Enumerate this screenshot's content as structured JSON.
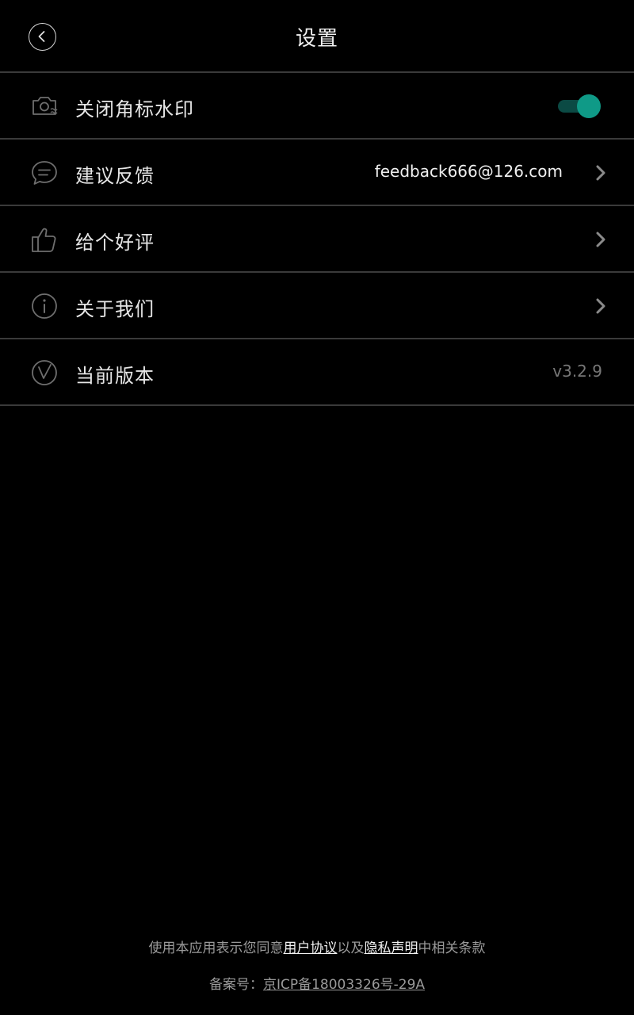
{
  "header": {
    "title": "设置",
    "back_icon": "chevron-left-icon"
  },
  "settings": [
    {
      "label": "关闭角标水印",
      "icon": "camera-watermark-icon",
      "control": "toggle",
      "toggle_on": true
    },
    {
      "label": "建议反馈",
      "icon": "message-icon",
      "value": "feedback666@126.com",
      "control": "chevron"
    },
    {
      "label": "给个好评",
      "icon": "thumbs-up-icon",
      "control": "chevron"
    },
    {
      "label": "关于我们",
      "icon": "info-icon",
      "control": "chevron"
    },
    {
      "label": "当前版本",
      "icon": "version-v-icon",
      "value": "v3.2.9",
      "control": "none"
    }
  ],
  "footer": {
    "agreement_prefix": "使用本应用表示您同意",
    "user_agreement_link": "用户协议",
    "agreement_middle": "以及",
    "privacy_link": "隐私声明",
    "agreement_suffix": "中相关条款",
    "icp_prefix": "备案号：",
    "icp_number": "京ICP备18003326号-29A"
  },
  "colors": {
    "background": "#000000",
    "divider": "#3a3a3a",
    "toggle_accent": "#0f9a87",
    "toggle_track": "#0b4a44",
    "muted_text": "#777777"
  }
}
